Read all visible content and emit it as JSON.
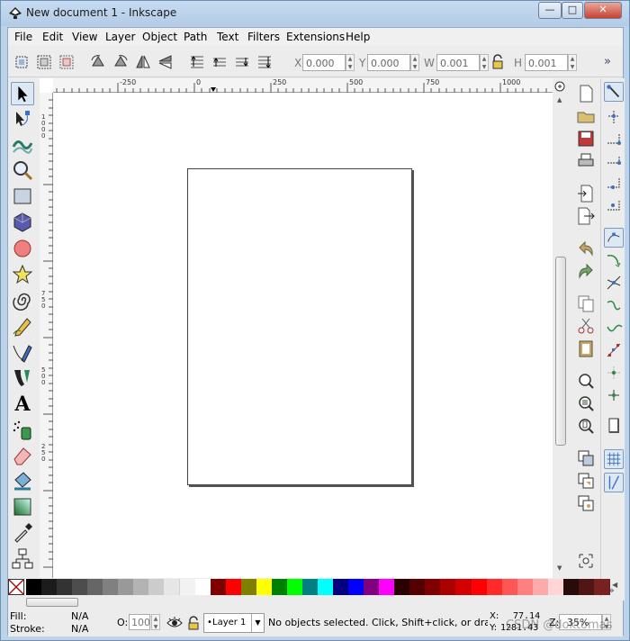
{
  "window": {
    "title": "New document 1 - Inkscape",
    "controls": {
      "minimize": "—",
      "maximize": "□",
      "close": "✕"
    }
  },
  "menu": [
    "File",
    "Edit",
    "View",
    "Layer",
    "Object",
    "Path",
    "Text",
    "Filters",
    "Extensions",
    "Help"
  ],
  "toolbar": {
    "x_label": "X",
    "x_value": "0.000",
    "y_label": "Y",
    "y_value": "0.000",
    "w_label": "W",
    "w_value": "0.001",
    "h_label": "H",
    "h_value": "0.001",
    "more": "»"
  },
  "rulers": {
    "h_ticks": [
      "-250",
      "0",
      "250",
      "500",
      "750",
      "1000"
    ],
    "v_ticks": [
      "1000",
      "750",
      "500",
      "250"
    ]
  },
  "palette_colors": [
    "#000000",
    "#1c1c1c",
    "#333333",
    "#4d4d4d",
    "#666666",
    "#808080",
    "#999999",
    "#b3b3b3",
    "#cccccc",
    "#e6e6e6",
    "#f2f2f2",
    "#ffffff",
    "#800000",
    "#ff0000",
    "#808000",
    "#ffff00",
    "#008000",
    "#00ff00",
    "#008080",
    "#00ffff",
    "#000080",
    "#0000ff",
    "#800080",
    "#ff00ff",
    "#2b0000",
    "#550000",
    "#800000",
    "#aa0000",
    "#d40000",
    "#ff0000",
    "#ff2a2a",
    "#ff5555",
    "#ff8080",
    "#ffaaaa",
    "#ffd5d5",
    "#280b0b",
    "#501616",
    "#782121"
  ],
  "status": {
    "fill_label": "Fill:",
    "fill_value": "N/A",
    "stroke_label": "Stroke:",
    "stroke_value": "N/A",
    "opacity_label": "O:",
    "opacity_value": "100",
    "layer": "Layer 1",
    "message": "No objects selected. Click, Shift+click, or drag ar",
    "x_label": "X:",
    "x_value": "77.14",
    "y_label": "Y:",
    "y_value": "1281.43",
    "zoom_label": "Z:",
    "zoom_value": "35%",
    "watermark": "CSDN @doktomas"
  }
}
